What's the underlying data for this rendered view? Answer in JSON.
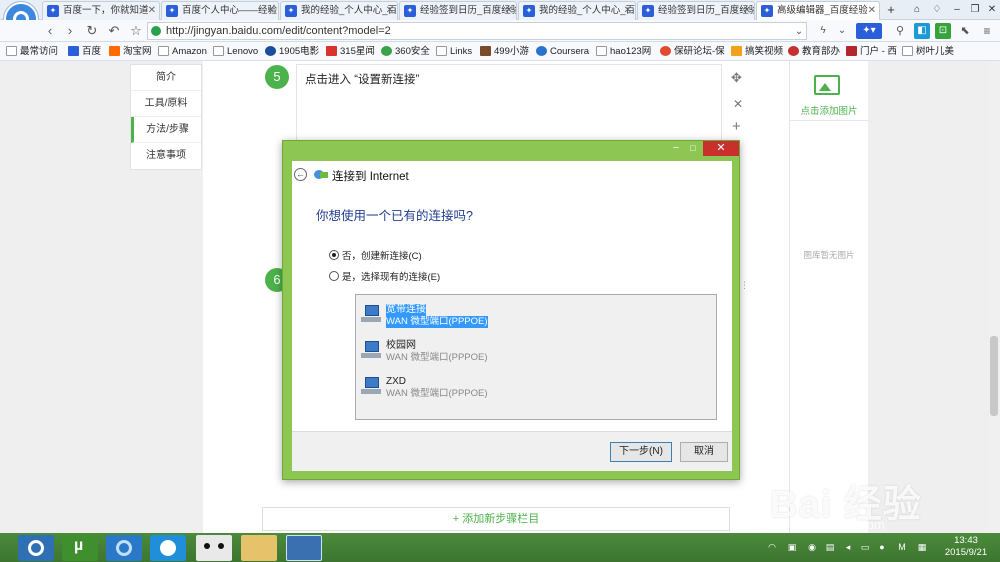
{
  "tabs": [
    {
      "label": "百度一下，你就知道"
    },
    {
      "label": "百度个人中心——经验"
    },
    {
      "label": "我的经验_个人中心_百度经验"
    },
    {
      "label": "经验签到日历_百度经验"
    },
    {
      "label": "我的经验_个人中心_百度经验"
    },
    {
      "label": "经验签到日历_百度经验"
    },
    {
      "label": "高级编辑器_百度经验"
    }
  ],
  "new_tab_label": "+",
  "address": {
    "url": "http://jingyan.baidu.com/edit/content?model=2"
  },
  "bookmarks": [
    "最常访问",
    "百度",
    "淘宝网",
    "Amazon",
    "Lenovo",
    "1905电影",
    "315星闻",
    "360安全",
    "Links",
    "499小游",
    "Coursera",
    "hao123网",
    "保研论坛-保",
    "搞笑视频",
    "教育部办",
    "门户 - 西",
    "树叶儿美"
  ],
  "sidenav": {
    "items": [
      "简介",
      "工具/原料",
      "方法/步骤",
      "注意事项"
    ]
  },
  "step5": {
    "number": "5",
    "text": "点击进入 “设置新连接”"
  },
  "step6": {
    "number": "6"
  },
  "rightpanel": {
    "add_image": "点击添加图片",
    "no_image": "图库暂无图片"
  },
  "add_step_label": "+ 添加新步骤栏目",
  "dialog": {
    "title": "连接到 Internet",
    "question": "你想使用一个已有的连接吗?",
    "options": [
      {
        "label": "否，创建新连接(C)",
        "selected": true
      },
      {
        "label": "是，选择现有的连接(E)",
        "selected": false
      }
    ],
    "connections": [
      {
        "name": "宽带连接",
        "desc": "WAN 微型端口(PPPOE)",
        "selected": true
      },
      {
        "name": "校园网",
        "desc": "WAN 微型端口(PPPOE)",
        "selected": false
      },
      {
        "name": "ZXD",
        "desc": "WAN 微型端口(PPPOE)",
        "selected": false
      }
    ],
    "next_button": "下一步(N)",
    "cancel_button": "取消",
    "controls": {
      "minimize": "–",
      "maximize": "□",
      "close": "✕"
    }
  },
  "taskbar": {
    "clock_time": "13:43",
    "clock_date": "2015/9/21"
  },
  "watermark": {
    "text": "Bai 经验",
    "url": "jingyan.baidu.com"
  },
  "colors": {
    "accent_green": "#4cb24c",
    "dialog_frame": "#8dc653",
    "close_red": "#c9302c",
    "selection_blue": "#3399ff"
  }
}
